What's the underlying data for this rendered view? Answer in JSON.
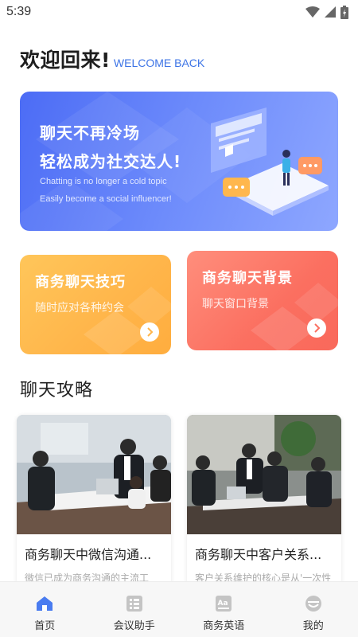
{
  "status_bar": {
    "time": "5:39",
    "icons": [
      "wifi-icon",
      "signal-icon",
      "battery-icon"
    ]
  },
  "greeting": {
    "title": "欢迎回来!",
    "subtitle": "WELCOME BACK"
  },
  "banner": {
    "line1": "聊天不再冷场",
    "line2": "轻松成为社交达人!",
    "en_line1": "Chatting is no longer a cold topic",
    "en_line2": "Easily become a social influencer!"
  },
  "cards": [
    {
      "title": "商务聊天技巧",
      "subtitle": "随时应对各种约会"
    },
    {
      "title": "商务聊天背景",
      "subtitle": "聊天窗口背景"
    }
  ],
  "section": {
    "title": "聊天攻略"
  },
  "articles": [
    {
      "title": "商务聊天中微信沟通...",
      "desc": "微信已成为商务沟通的主流工"
    },
    {
      "title": "商务聊天中客户关系...",
      "desc": "客户关系维护的核心是从'一次性"
    }
  ],
  "nav": [
    {
      "label": "首页",
      "icon": "home-icon",
      "active": true
    },
    {
      "label": "会议助手",
      "icon": "list-icon",
      "active": false
    },
    {
      "label": "商务英语",
      "icon": "dictionary-icon",
      "active": false
    },
    {
      "label": "我的",
      "icon": "profile-icon",
      "active": false
    }
  ],
  "colors": {
    "accent": "#3d74e6",
    "banner": "#5b7cf8",
    "card_yellow": "#ffb54a",
    "card_red": "#fb6f60",
    "nav_active": "#4a7cf0",
    "nav_inactive": "#c4c4c4"
  }
}
